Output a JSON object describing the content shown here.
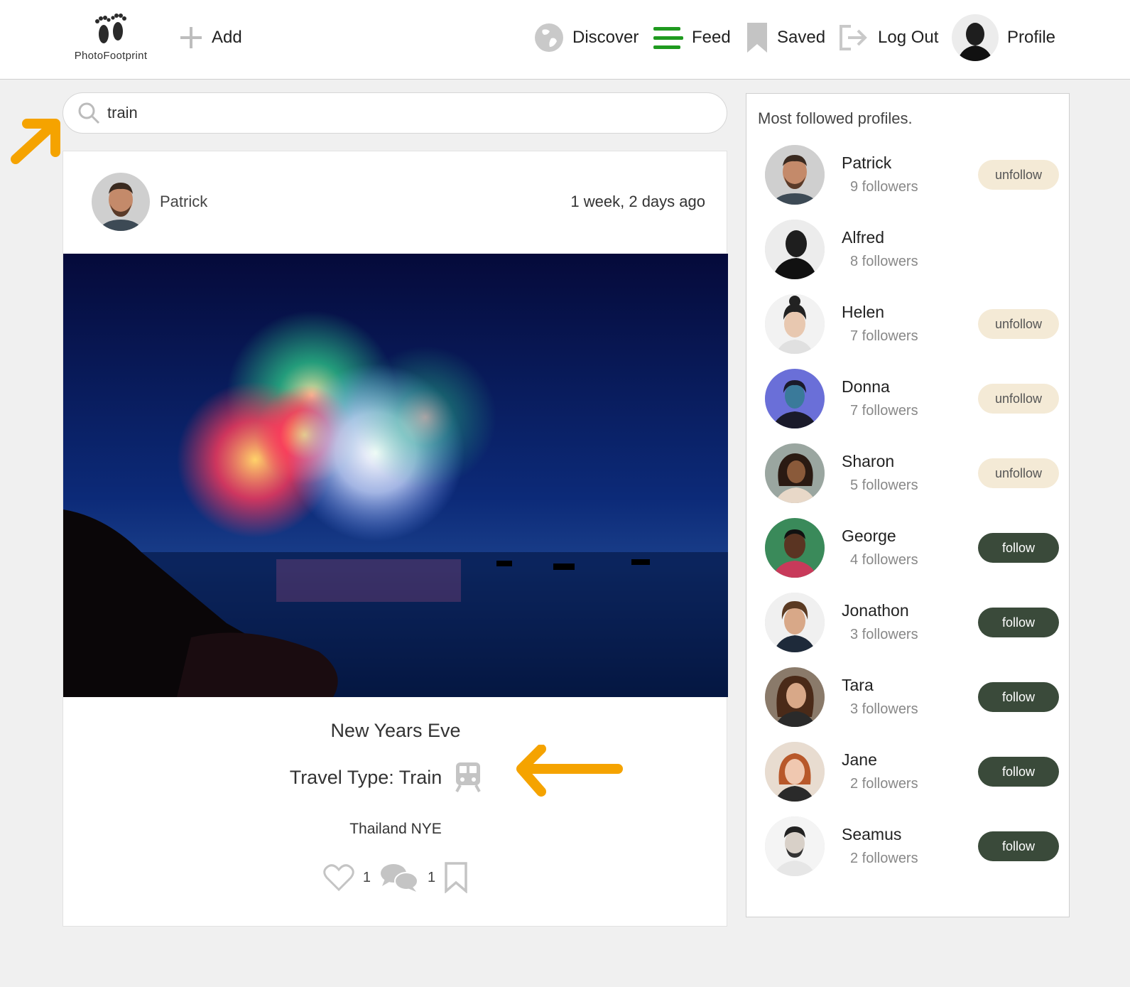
{
  "header": {
    "logo_text": "PhotoFootprint",
    "add_label": "Add",
    "discover_label": "Discover",
    "feed_label": "Feed",
    "saved_label": "Saved",
    "logout_label": "Log Out",
    "profile_label": "Profile"
  },
  "search": {
    "value": "train"
  },
  "post": {
    "author": "Patrick",
    "time_ago": "1 week, 2 days ago",
    "title": "New Years Eve",
    "travel_type": "Travel Type: Train",
    "location": "Thailand NYE",
    "likes": "1",
    "comments": "1"
  },
  "sidebar": {
    "title": "Most followed profiles.",
    "profiles": [
      {
        "name": "Patrick",
        "followers": "9 followers",
        "button": "unfollow"
      },
      {
        "name": "Alfred",
        "followers": "8 followers",
        "button": ""
      },
      {
        "name": "Helen",
        "followers": "7 followers",
        "button": "unfollow"
      },
      {
        "name": "Donna",
        "followers": "7 followers",
        "button": "unfollow"
      },
      {
        "name": "Sharon",
        "followers": "5 followers",
        "button": "unfollow"
      },
      {
        "name": "George",
        "followers": "4 followers",
        "button": "follow"
      },
      {
        "name": "Jonathon",
        "followers": "3 followers",
        "button": "follow"
      },
      {
        "name": "Tara",
        "followers": "3 followers",
        "button": "follow"
      },
      {
        "name": "Jane",
        "followers": "2 followers",
        "button": "follow"
      },
      {
        "name": "Seamus",
        "followers": "2 followers",
        "button": "follow"
      }
    ]
  },
  "colors": {
    "accent_arrow": "#f5a300",
    "follow_button": "#3a4a3a",
    "unfollow_button": "#f4ead6",
    "feed_icon": "#1f9a1f"
  }
}
